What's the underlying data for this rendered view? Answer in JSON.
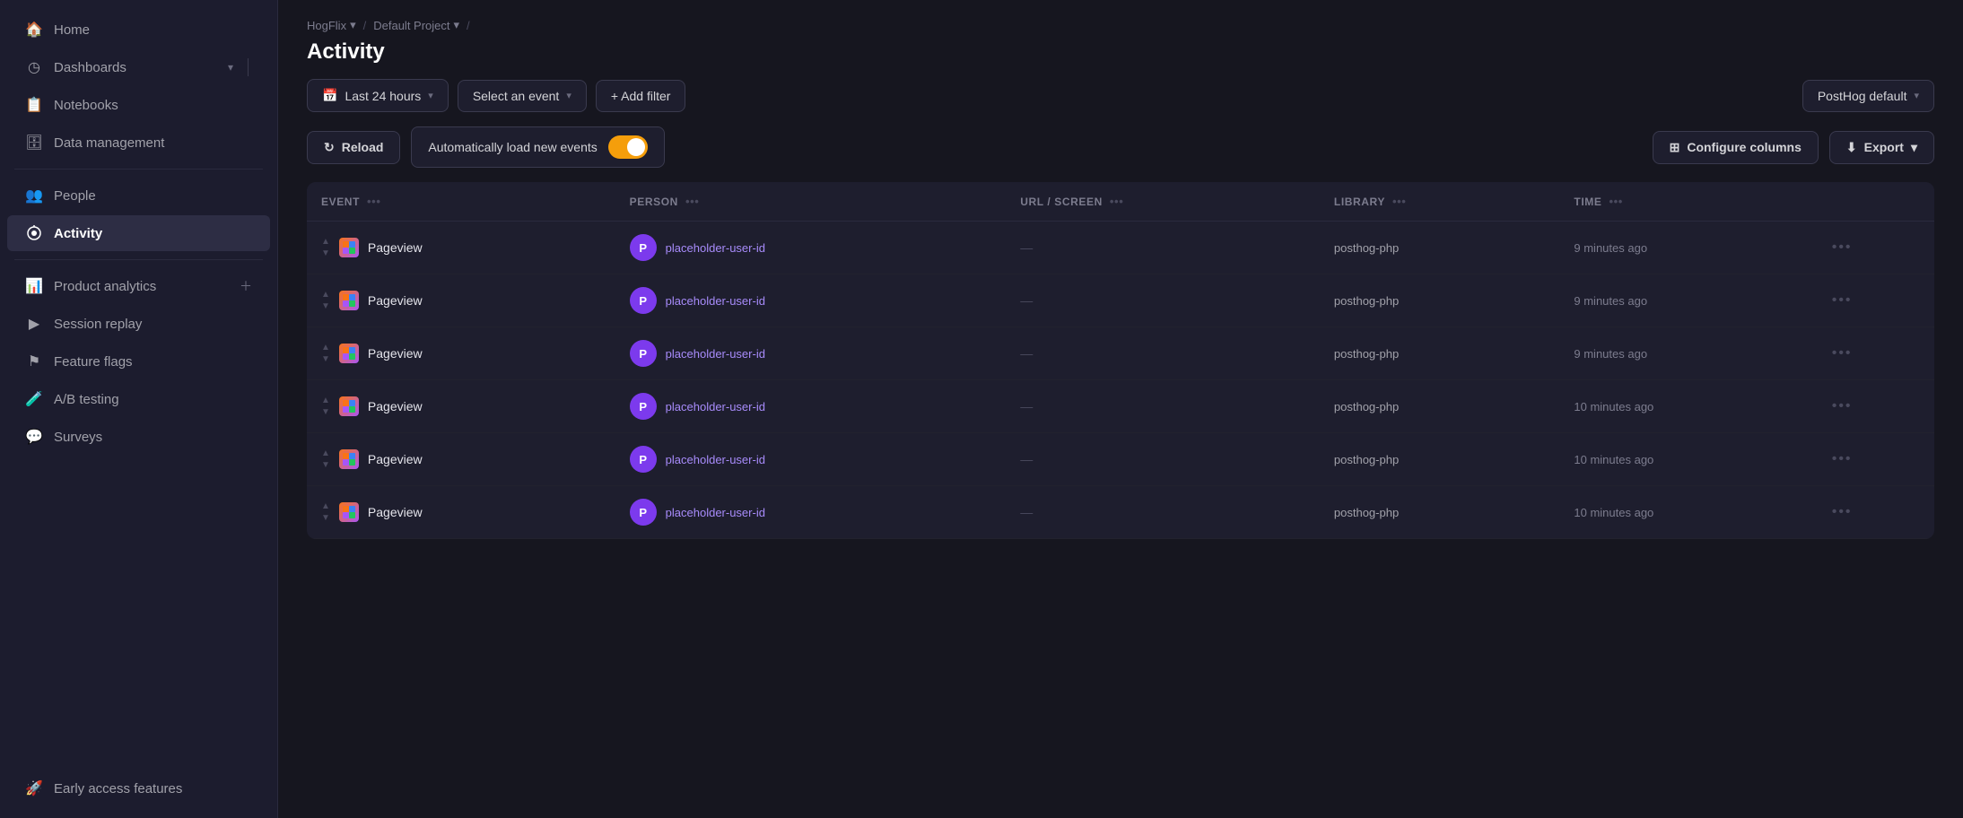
{
  "sidebar": {
    "items": [
      {
        "id": "home",
        "label": "Home",
        "icon": "🏠",
        "active": false
      },
      {
        "id": "dashboards",
        "label": "Dashboards",
        "icon": "◷",
        "active": false,
        "hasChevron": true
      },
      {
        "id": "notebooks",
        "label": "Notebooks",
        "icon": "📋",
        "active": false
      },
      {
        "id": "data-management",
        "label": "Data management",
        "icon": "🗄",
        "active": false
      },
      {
        "id": "people",
        "label": "People",
        "icon": "👥",
        "active": false
      },
      {
        "id": "activity",
        "label": "Activity",
        "icon": "📡",
        "active": true
      },
      {
        "id": "product-analytics",
        "label": "Product analytics",
        "icon": "📊",
        "active": false,
        "hasPlus": true
      },
      {
        "id": "session-replay",
        "label": "Session replay",
        "icon": "▶",
        "active": false
      },
      {
        "id": "feature-flags",
        "label": "Feature flags",
        "icon": "⚑",
        "active": false
      },
      {
        "id": "ab-testing",
        "label": "A/B testing",
        "icon": "🧪",
        "active": false
      },
      {
        "id": "surveys",
        "label": "Surveys",
        "icon": "💬",
        "active": false
      },
      {
        "id": "early-access",
        "label": "Early access features",
        "icon": "🚀",
        "active": false
      }
    ]
  },
  "breadcrumb": {
    "org": "HogFlix",
    "project": "Default Project"
  },
  "page": {
    "title": "Activity"
  },
  "toolbar": {
    "time_range_label": "Last 24 hours",
    "event_select_label": "Select an event",
    "add_filter_label": "+ Add filter",
    "theme_label": "PostHog default"
  },
  "action_bar": {
    "reload_label": "Reload",
    "auto_load_label": "Automatically load new events",
    "auto_load_enabled": true,
    "configure_columns_label": "Configure columns",
    "export_label": "Export"
  },
  "table": {
    "columns": [
      {
        "id": "event",
        "label": "EVENT"
      },
      {
        "id": "person",
        "label": "PERSON"
      },
      {
        "id": "url_screen",
        "label": "URL / SCREEN"
      },
      {
        "id": "library",
        "label": "LIBRARY"
      },
      {
        "id": "time",
        "label": "TIME"
      }
    ],
    "rows": [
      {
        "event": "Pageview",
        "person_initial": "P",
        "person_id": "placeholder-user-id",
        "url": "—",
        "library": "posthog-php",
        "time": "9 minutes ago"
      },
      {
        "event": "Pageview",
        "person_initial": "P",
        "person_id": "placeholder-user-id",
        "url": "—",
        "library": "posthog-php",
        "time": "9 minutes ago"
      },
      {
        "event": "Pageview",
        "person_initial": "P",
        "person_id": "placeholder-user-id",
        "url": "—",
        "library": "posthog-php",
        "time": "9 minutes ago"
      },
      {
        "event": "Pageview",
        "person_initial": "P",
        "person_id": "placeholder-user-id",
        "url": "—",
        "library": "posthog-php",
        "time": "10 minutes ago"
      },
      {
        "event": "Pageview",
        "person_initial": "P",
        "person_id": "placeholder-user-id",
        "url": "—",
        "library": "posthog-php",
        "time": "10 minutes ago"
      },
      {
        "event": "Pageview",
        "person_initial": "P",
        "person_id": "placeholder-user-id",
        "url": "—",
        "library": "posthog-php",
        "time": "10 minutes ago"
      }
    ]
  },
  "colors": {
    "accent": "#f59e0b",
    "active_bg": "#2d2d44",
    "sidebar_bg": "#1c1c2e",
    "main_bg": "#16161f",
    "surface": "#1e1e2e",
    "border": "#2a2a3e",
    "avatar_purple": "#7c3aed",
    "person_link": "#a78bfa"
  }
}
